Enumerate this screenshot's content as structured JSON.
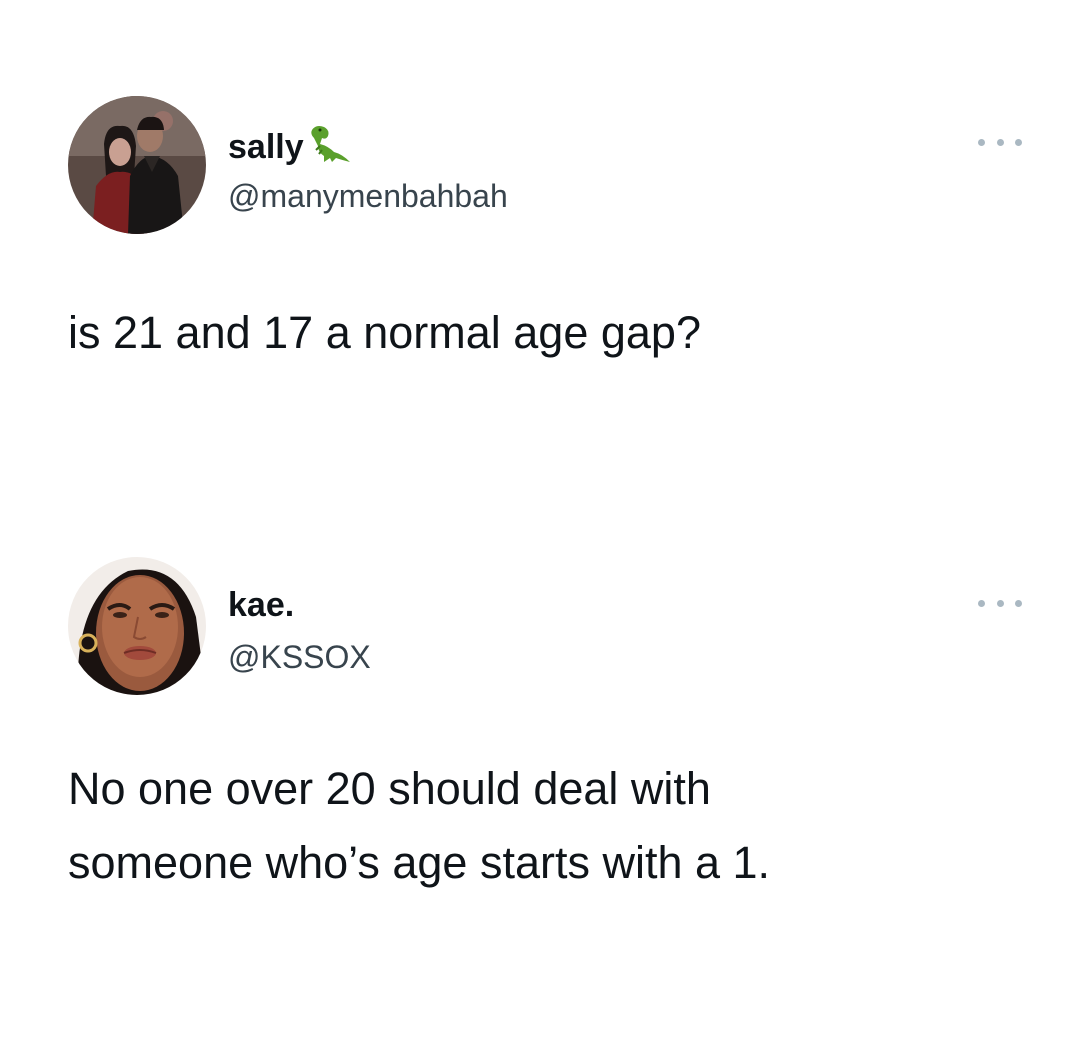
{
  "tweets": [
    {
      "display_name": "sally",
      "name_emoji_icon": "t-rex-emoji-icon",
      "handle": "@manymenbahbah",
      "text": "is 21 and 17 a normal age gap?",
      "more_icon": "more-options-icon"
    },
    {
      "display_name": "kae.",
      "handle": "@KSSOX",
      "text_lines": [
        "No one over 20 should deal with",
        "someone who’s age starts with a 1."
      ],
      "more_icon": "more-options-icon"
    }
  ],
  "colors": {
    "text": "#0f1419",
    "handle": "#38444d",
    "more_dots": "#aab8c2",
    "background": "#ffffff"
  }
}
